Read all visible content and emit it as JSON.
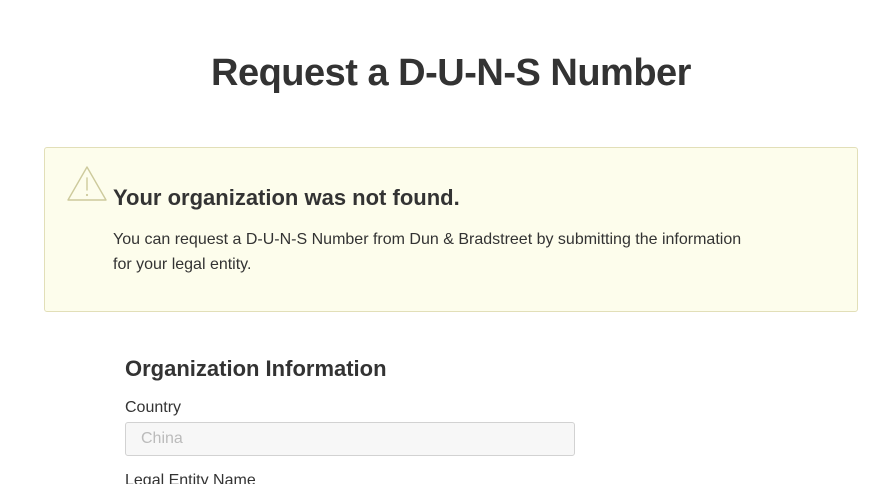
{
  "page": {
    "title": "Request a D-U-N-S Number"
  },
  "alert": {
    "icon": "warning-triangle-icon",
    "title": "Your organization was not found.",
    "body": "You can request a D-U-N-S Number from Dun & Bradstreet by submitting the information for your legal entity.",
    "background_color": "#fdfdec",
    "border_color": "#e2dfb8"
  },
  "organization": {
    "section_title": "Organization Information",
    "country_label": "Country",
    "country_value": "China",
    "legal_entity_label": "Legal Entity Name"
  }
}
